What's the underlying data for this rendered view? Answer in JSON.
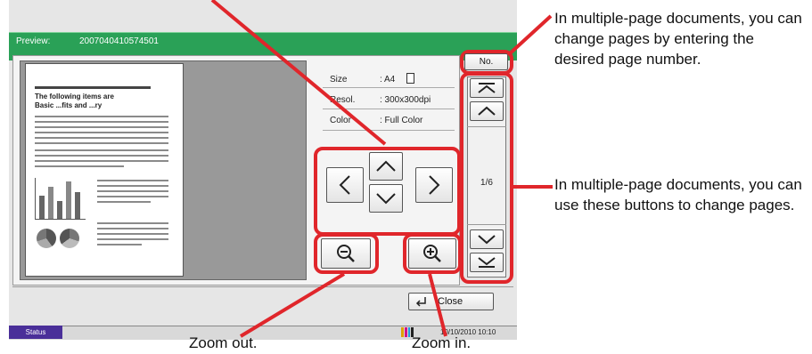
{
  "title_bar": {
    "label": "Preview:",
    "job_id": "2007040410574501"
  },
  "info": {
    "size_label": "Size",
    "size_value": ": A4",
    "resol_label": "Resol.",
    "resol_value": ": 300x300dpi",
    "color_label": "Color",
    "color_value": ": Full Color"
  },
  "doc_preview": {
    "heading": "The following items are",
    "heading2": "Basic ...fits and ...ry"
  },
  "page_nav": {
    "no_label": "No.",
    "page_indicator": "1/6"
  },
  "close_label": "Close",
  "status": {
    "label": "Status",
    "datetime": "10/10/2010 10:10"
  },
  "callouts": {
    "page_number": "In multiple-page documents, you can change pages by entering the desired page number.",
    "page_buttons": "In multiple-page documents, you can use these buttons to change pages.",
    "zoom_out": "Zoom out.",
    "zoom_in": "Zoom in."
  },
  "colors": {
    "accent_green": "#2aa157",
    "callout_red": "#e0262b",
    "status_purple": "#4a2f99"
  },
  "icons": [
    "arrow-left-icon",
    "arrow-up-icon",
    "arrow-right-icon",
    "arrow-down-icon",
    "zoom-out-icon",
    "zoom-in-icon",
    "first-page-icon",
    "prev-page-icon",
    "next-page-icon",
    "last-page-icon",
    "enter-icon",
    "page-portrait-icon",
    "toner-icon"
  ]
}
